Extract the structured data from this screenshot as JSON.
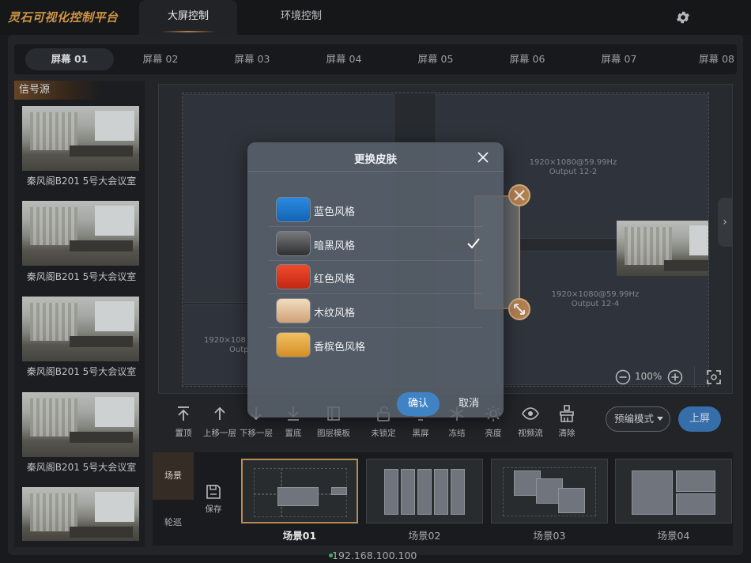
{
  "app": {
    "title": "灵石可视化控制平台"
  },
  "top_tabs": [
    {
      "label": "大屏控制",
      "active": true
    },
    {
      "label": "环境控制",
      "active": false
    }
  ],
  "top_icons": {
    "settings": "gear-icon"
  },
  "screen_tabs": [
    "屏幕 01",
    "屏幕 02",
    "屏幕 03",
    "屏幕 04",
    "屏幕 05",
    "屏幕 06",
    "屏幕 07",
    "屏幕 08"
  ],
  "active_screen": "屏幕 01",
  "signal_source": {
    "title": "信号源",
    "items": [
      {
        "label": "秦风阁B201 5号大会议室"
      },
      {
        "label": "秦风阁B201 5号大会议室"
      },
      {
        "label": "秦风阁B201 5号大会议室"
      },
      {
        "label": "秦风阁B201 5号大会议室"
      },
      {
        "label": ""
      }
    ]
  },
  "canvas": {
    "outputs": [
      {
        "res": "1920×1080@59.99Hz",
        "name": "Output 12-2"
      },
      {
        "res": "1920×1080@59.99Hz",
        "name": "Output 12-4"
      },
      {
        "res": "1920×108",
        "name": "Outp"
      }
    ],
    "window_label": "秦风阁B201 5号大会议室",
    "zoom": "100%"
  },
  "toolbar": {
    "items": [
      {
        "label": "置顶",
        "icon": "bring-to-top-icon"
      },
      {
        "label": "上移一层",
        "icon": "move-up-icon"
      },
      {
        "label": "下移一层",
        "icon": "move-down-icon"
      },
      {
        "label": "置底",
        "icon": "send-to-bottom-icon"
      },
      {
        "label": "图层模板",
        "icon": "layer-template-icon"
      },
      {
        "label": "未锁定",
        "icon": "unlock-icon"
      },
      {
        "label": "黑屏",
        "icon": "black-screen-icon"
      },
      {
        "label": "冻结",
        "icon": "freeze-icon"
      },
      {
        "label": "亮度",
        "icon": "brightness-icon"
      },
      {
        "label": "视频流",
        "icon": "eye-icon"
      },
      {
        "label": "清除",
        "icon": "brush-icon"
      }
    ],
    "mode": "预编模式",
    "upscreen": "上屏"
  },
  "scene_panel": {
    "tabs": [
      "场景",
      "轮巡"
    ],
    "save_label": "保存",
    "scenes": [
      {
        "label": "场景01",
        "selected": true
      },
      {
        "label": "场景02",
        "selected": false
      },
      {
        "label": "场景03",
        "selected": false
      },
      {
        "label": "场景04",
        "selected": false
      }
    ]
  },
  "status": {
    "ip": "192.168.100.100"
  },
  "dialog": {
    "title": "更换皮肤",
    "options": [
      {
        "label": "蓝色风格",
        "color": "#1a73c8",
        "selected": false
      },
      {
        "label": "暗黑风格",
        "color": "#4a4b4d",
        "selected": true
      },
      {
        "label": "红色风格",
        "color": "#d8321e",
        "selected": false
      },
      {
        "label": "木纹风格",
        "color": "#e3c09a",
        "selected": false
      },
      {
        "label": "香槟色风格",
        "color": "#e0a43c",
        "selected": false
      }
    ],
    "confirm": "确认",
    "cancel": "取消"
  },
  "colors": {
    "accent": "#3f83c4",
    "brand": "#e2a14a",
    "handle": "#c08a57"
  }
}
